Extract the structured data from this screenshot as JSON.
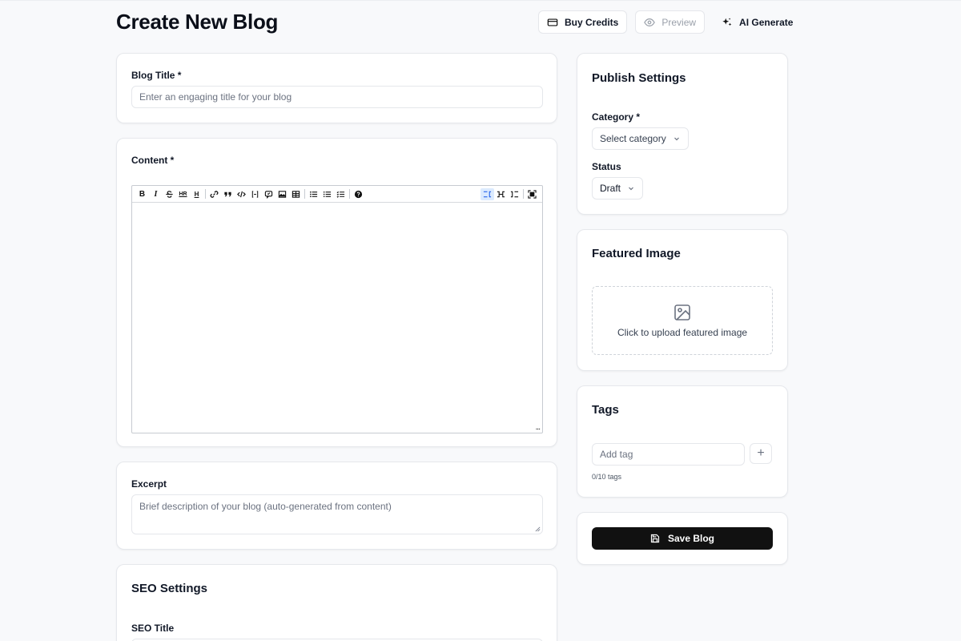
{
  "header": {
    "title": "Create New Blog",
    "buy_credits": "Buy Credits",
    "preview": "Preview",
    "ai_generate": "AI Generate"
  },
  "blog_title": {
    "label": "Blog Title *",
    "placeholder": "Enter an engaging title for your blog"
  },
  "content": {
    "label": "Content *",
    "toolbar": {
      "bold": "B",
      "italic": "I",
      "hr": "HR",
      "heading": "H"
    },
    "resize_handle": "..."
  },
  "excerpt": {
    "label": "Excerpt",
    "placeholder": "Brief description of your blog (auto-generated from content)"
  },
  "seo": {
    "heading": "SEO Settings",
    "title_label": "SEO Title"
  },
  "publish": {
    "heading": "Publish Settings",
    "category_label": "Category *",
    "category_value": "Select category",
    "status_label": "Status",
    "status_value": "Draft"
  },
  "featured_image": {
    "heading": "Featured Image",
    "upload_text": "Click to upload featured image"
  },
  "tags": {
    "heading": "Tags",
    "placeholder": "Add tag",
    "add_symbol": "+",
    "count_text": "0/10 tags"
  },
  "save": {
    "label": "Save Blog"
  },
  "colors": {
    "primary": "#111111",
    "background": "#f8f9fb",
    "border": "#e5e7eb",
    "active_toolbar": "#2563eb"
  }
}
